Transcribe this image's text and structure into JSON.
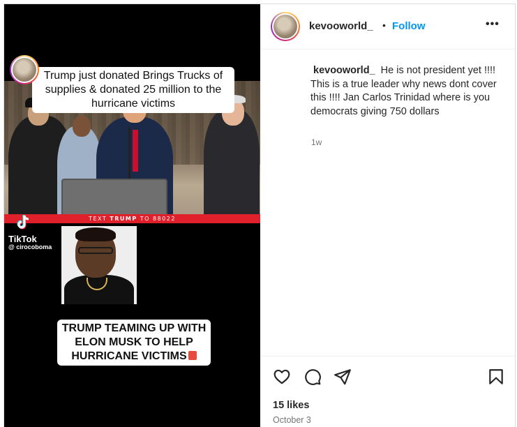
{
  "post": {
    "username": "kevooworld_",
    "separator": "•",
    "follow_label": "Follow",
    "more_label": "•••",
    "caption_username": "kevooworld_",
    "caption_text": "He is not president yet !!!! This is a true leader why news dont cover this !!!! Jan Carlos Trinidad where is you democrats giving 750 dollars",
    "caption_time": "1w",
    "likes": "15 likes",
    "date": "October 3"
  },
  "media": {
    "top_caption": "Trump just donated Brings Trucks of supplies & donated 25 million to the hurricane victims",
    "banner_prefix": "TEXT ",
    "banner_bold": "TRUMP",
    "banner_suffix": " TO 88022",
    "bottom_caption": "TRUMP TEAMING UP WITH ELON MUSK TO HELP HURRICANE VICTIMS",
    "tiktok_label": "TikTok",
    "tiktok_handle": "@ cirocoboma"
  },
  "icons": {
    "like": "heart-icon",
    "comment": "comment-bubble-icon",
    "share": "paper-plane-icon",
    "save": "bookmark-icon",
    "more": "more-options-icon"
  },
  "colors": {
    "follow": "#0095f6",
    "banner": "#e0202a",
    "text": "#262626",
    "muted": "#737373"
  }
}
